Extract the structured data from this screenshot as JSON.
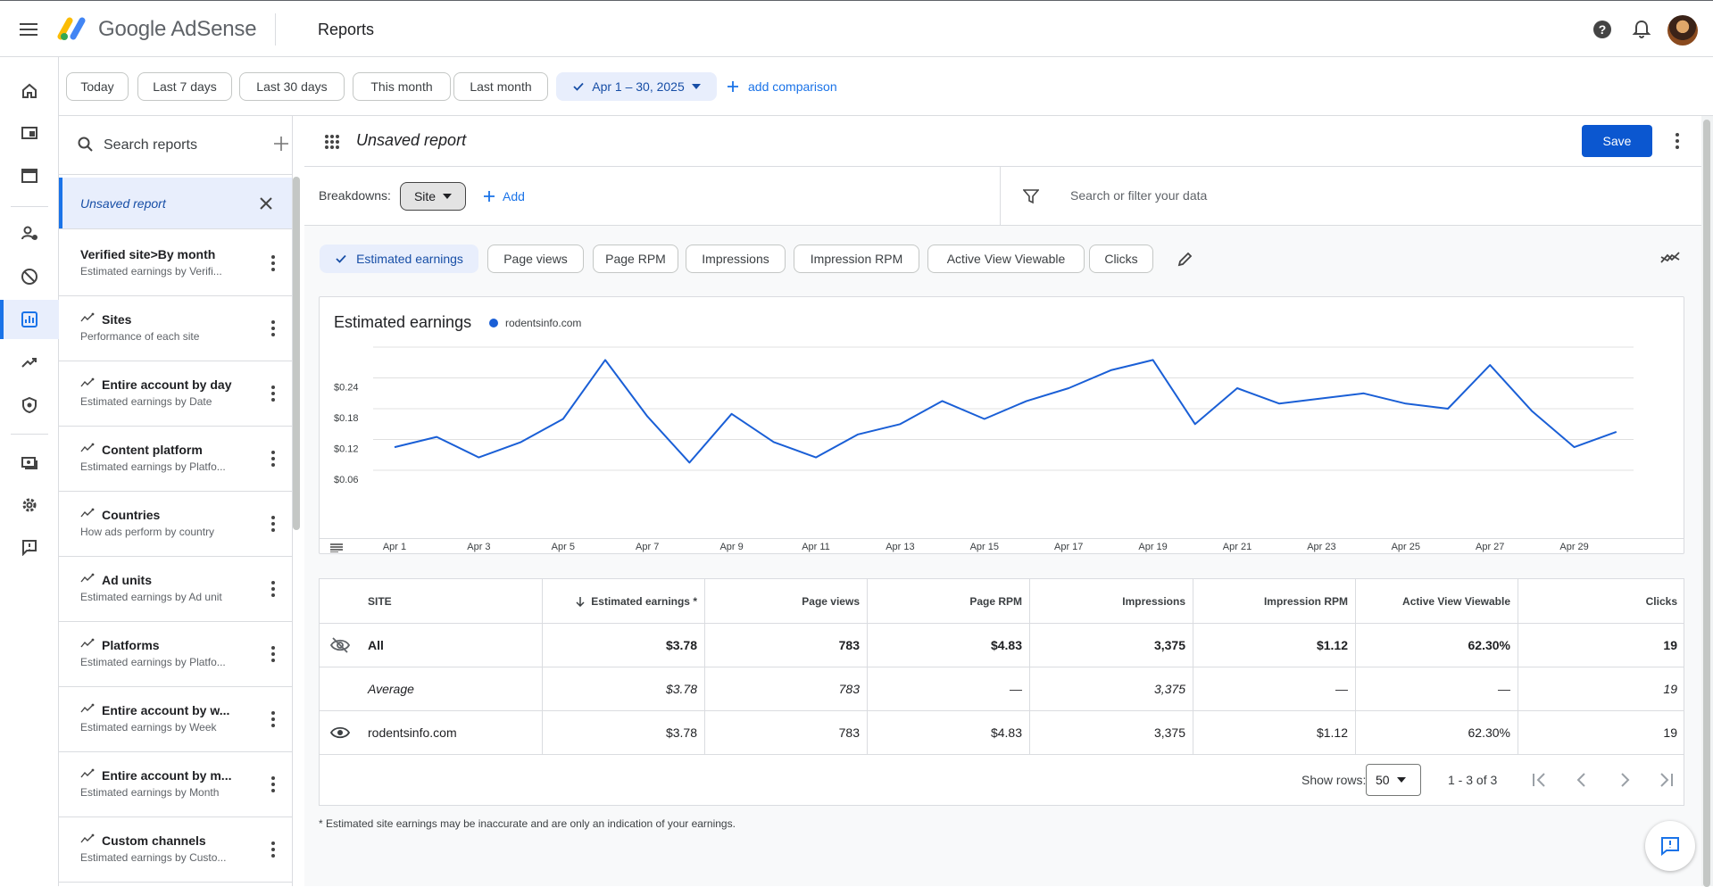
{
  "app": {
    "brand": "Google AdSense",
    "page_title": "Reports"
  },
  "date_filters": {
    "presets": [
      "Today",
      "Last 7 days",
      "Last 30 days",
      "This month",
      "Last month"
    ],
    "selected_range": "Apr 1 – 30, 2025",
    "add_comparison": "add comparison"
  },
  "sidebar": {
    "search_label": "Search reports",
    "current": {
      "title": "Unsaved report"
    },
    "items": [
      {
        "title": "Verified site>By month",
        "subtitle": "Estimated earnings by Verifi..."
      },
      {
        "title": "Sites",
        "subtitle": "Performance of each site"
      },
      {
        "title": "Entire account by day",
        "subtitle": "Estimated earnings by Date"
      },
      {
        "title": "Content platform",
        "subtitle": "Estimated earnings by Platfo..."
      },
      {
        "title": "Countries",
        "subtitle": "How ads perform by country"
      },
      {
        "title": "Ad units",
        "subtitle": "Estimated earnings by Ad unit"
      },
      {
        "title": "Platforms",
        "subtitle": "Estimated earnings by Platfo..."
      },
      {
        "title": "Entire account by w...",
        "subtitle": "Estimated earnings by Week"
      },
      {
        "title": "Entire account by m...",
        "subtitle": "Estimated earnings by Month"
      },
      {
        "title": "Custom channels",
        "subtitle": "Estimated earnings by Custo..."
      }
    ]
  },
  "report": {
    "name": "Unsaved report",
    "save_label": "Save",
    "breakdowns_label": "Breakdowns:",
    "breakdown_value": "Site",
    "add_label": "Add",
    "filter_placeholder": "Search or filter your data",
    "metrics": [
      "Estimated earnings",
      "Page views",
      "Page RPM",
      "Impressions",
      "Impression RPM",
      "Active View Viewable",
      "Clicks"
    ],
    "selected_metric": "Estimated earnings"
  },
  "chart_data": {
    "type": "line",
    "title": "Estimated earnings",
    "series": [
      {
        "name": "rodentsinfo.com",
        "color": "#1a5fd6",
        "values": [
          0.105,
          0.125,
          0.085,
          0.115,
          0.16,
          0.275,
          0.165,
          0.075,
          0.17,
          0.115,
          0.085,
          0.13,
          0.15,
          0.195,
          0.16,
          0.195,
          0.22,
          0.255,
          0.275,
          0.15,
          0.22,
          0.19,
          0.2,
          0.21,
          0.19,
          0.18,
          0.265,
          0.175,
          0.105,
          0.135
        ]
      }
    ],
    "x_labels": [
      "Apr 1",
      "Apr 3",
      "Apr 5",
      "Apr 7",
      "Apr 9",
      "Apr 11",
      "Apr 13",
      "Apr 15",
      "Apr 17",
      "Apr 19",
      "Apr 21",
      "Apr 23",
      "Apr 25",
      "Apr 27",
      "Apr 29"
    ],
    "y_ticks": [
      "$0.24",
      "$0.18",
      "$0.12",
      "$0.06"
    ],
    "ylim": [
      0.06,
      0.3
    ],
    "grid": true
  },
  "table": {
    "columns": [
      "SITE",
      "Estimated earnings *",
      "Page views",
      "Page RPM",
      "Impressions",
      "Impression RPM",
      "Active View Viewable",
      "Clicks"
    ],
    "rows": [
      {
        "label": "All",
        "cells": [
          "$3.78",
          "783",
          "$4.83",
          "3,375",
          "$1.12",
          "62.30%",
          "19"
        ]
      },
      {
        "label": "Average",
        "cells": [
          "$3.78",
          "783",
          "—",
          "3,375",
          "—",
          "—",
          "19"
        ]
      },
      {
        "label": "rodentsinfo.com",
        "cells": [
          "$3.78",
          "783",
          "$4.83",
          "3,375",
          "$1.12",
          "62.30%",
          "19"
        ]
      }
    ],
    "show_rows_label": "Show rows:",
    "rows_per_page": "50",
    "range_text": "1 - 3 of 3"
  },
  "footnote": "* Estimated site earnings may be inaccurate and are only an indication of your earnings."
}
